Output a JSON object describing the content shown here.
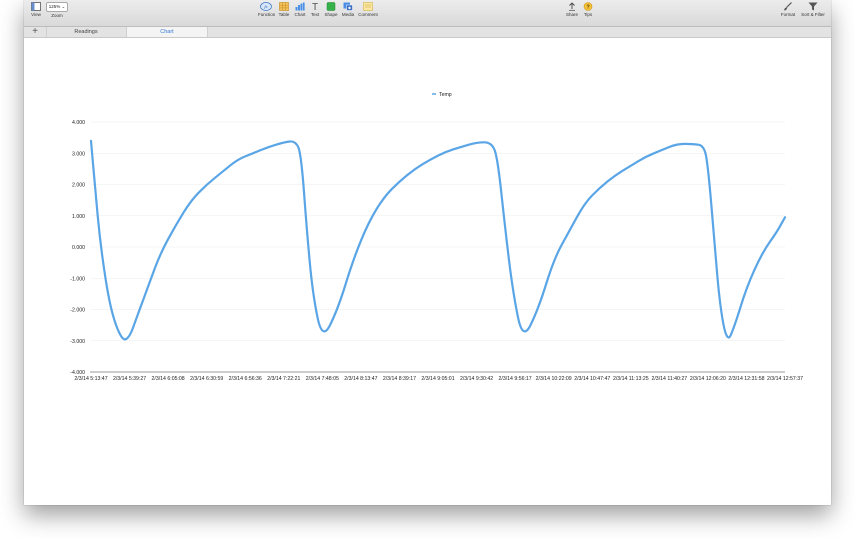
{
  "toolbar": {
    "view_label": "View",
    "zoom_value": "125%",
    "zoom_label": "Zoom",
    "function_label": "Function",
    "table_label": "Table",
    "chart_label": "Chart",
    "text_label": "Text",
    "shape_label": "Shape",
    "media_label": "Media",
    "comment_label": "Comment",
    "share_label": "Share",
    "tips_label": "Tips",
    "format_label": "Format",
    "sort_filter_label": "Sort & Filter"
  },
  "tabs": [
    {
      "label": "Readings",
      "active": false
    },
    {
      "label": "Chart",
      "active": true
    }
  ],
  "colors": {
    "accent": "#3478d8",
    "series": "#5aa5e6",
    "gridline": "#ececec"
  },
  "chart_data": {
    "type": "line",
    "title": "",
    "xlabel": "",
    "ylabel": "",
    "legend_position": "top-center",
    "grid": true,
    "ylim": [
      -4,
      4
    ],
    "y_ticks": [
      "4.000",
      "3.000",
      "2.000",
      "1.000",
      "0.000",
      "-1.000",
      "-2.000",
      "-3.000",
      "-4.000"
    ],
    "x_ticks": [
      "2/3/14 5:13:47",
      "2/3/14 5:39:27",
      "2/3/14 6:05:08",
      "2/3/14 6:30:59",
      "2/3/14 6:56:36",
      "2/3/14 7:22:21",
      "2/3/14 7:48:05",
      "2/3/14 8:13:47",
      "2/3/14 8:39:17",
      "2/3/14 9:05:01",
      "2/3/14 9:30:42",
      "2/3/14 9:56:17",
      "2/3/14 10:22:09",
      "2/3/14 10:47:47",
      "2/3/14 11:13:25",
      "2/3/14 11:40:27",
      "2/3/14 12:06:20",
      "2/3/14 12:31:58",
      "2/3/14 12:57:37"
    ],
    "series": [
      {
        "name": "Temp",
        "x": [
          0,
          0.1,
          0.25,
          0.5,
          0.8,
          1.0,
          1.2,
          1.5,
          1.8,
          2.2,
          2.6,
          3.0,
          3.4,
          3.8,
          4.2,
          4.6,
          5.0,
          5.3,
          5.45,
          5.6,
          5.75,
          6.0,
          6.4,
          6.8,
          7.2,
          7.6,
          8.0,
          8.4,
          8.8,
          9.2,
          9.6,
          10.0,
          10.4,
          10.55,
          10.75,
          10.95,
          11.2,
          11.6,
          12.0,
          12.4,
          12.8,
          13.2,
          13.6,
          14.0,
          14.4,
          14.8,
          15.2,
          15.6,
          15.9,
          16.0,
          16.15,
          16.3,
          16.5,
          16.7,
          17.0,
          17.4,
          17.8,
          18.0
        ],
        "values": [
          3.4,
          2.0,
          0.0,
          -2.0,
          -3.0,
          -2.9,
          -2.2,
          -1.2,
          -0.2,
          0.7,
          1.5,
          2.0,
          2.4,
          2.8,
          3.0,
          3.2,
          3.35,
          3.4,
          3.0,
          0.5,
          -1.5,
          -3.0,
          -2.0,
          -0.4,
          0.8,
          1.6,
          2.1,
          2.5,
          2.8,
          3.05,
          3.2,
          3.35,
          3.35,
          2.8,
          0.5,
          -1.5,
          -3.0,
          -2.0,
          -0.4,
          0.5,
          1.4,
          1.9,
          2.3,
          2.6,
          2.9,
          3.1,
          3.3,
          3.3,
          3.25,
          2.6,
          0.5,
          -1.8,
          -3.1,
          -2.5,
          -1.3,
          -0.2,
          0.5,
          0.95
        ]
      }
    ]
  }
}
